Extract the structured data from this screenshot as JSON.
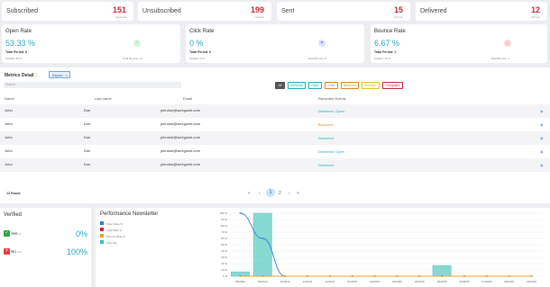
{
  "stats": [
    {
      "label": "Subscribed",
      "value": "151",
      "sub": "Add total"
    },
    {
      "label": "Unsubscribed",
      "value": "199",
      "sub": "Lifetime"
    },
    {
      "label": "Sent",
      "value": "15",
      "sub": "All time"
    },
    {
      "label": "Delivered",
      "value": "12",
      "sub": "All time"
    }
  ],
  "rates": [
    {
      "title": "Open Rate",
      "pct": "53.33 %",
      "total": "Total Period: 8",
      "foot_l": "Total(8): 53 %",
      "foot_r": "Total Bounce: 11",
      "icon": "trend-up-icon"
    },
    {
      "title": "Click Rate",
      "pct": "0 %",
      "total": "Total Period: 0",
      "foot_l": "Total(0): 0 %",
      "foot_r": "Total Bounce: 0",
      "icon": "click-icon"
    },
    {
      "title": "Bounce Rate",
      "pct": "6.67 %",
      "total": "Total Period: 1",
      "foot_l": "Total(1): 25 %",
      "foot_r": "Total Bounce: 1",
      "icon": "bounce-icon"
    }
  ],
  "metrics": {
    "title": "Metrics Detail",
    "export_label": "Export",
    "search_placeholder": "Search...",
    "filters": [
      {
        "label": "All",
        "color": "#555",
        "active": true
      },
      {
        "label": "Delivered",
        "color": "#2aa6bf"
      },
      {
        "label": "Open",
        "color": "#2aa6bf"
      },
      {
        "label": "Click",
        "color": "#e6822b"
      },
      {
        "label": "Bounced",
        "color": "#e6822b"
      },
      {
        "label": "Bounce",
        "color": "#e6c02b"
      },
      {
        "label": "Complaint",
        "color": "#c8283c"
      }
    ],
    "columns": {
      "name": "Name",
      "last": "Last name",
      "email": "Email",
      "events": "Recorded Events"
    },
    "rows": [
      {
        "name": "John",
        "last": "Doe",
        "email": "johndoe@we4guest.com",
        "events": "Delivered, Open",
        "color": "#2aa6bf"
      },
      {
        "name": "John",
        "last": "Doe",
        "email": "johndoe@we4guest.com",
        "events": "Bounced",
        "color": "#e6822b"
      },
      {
        "name": "John",
        "last": "Doe",
        "email": "johndoe@we4guest.com",
        "events": "Delivered",
        "color": "#2aa6bf"
      },
      {
        "name": "John",
        "last": "Doe",
        "email": "johndoe@we4guest.com",
        "events": "Delivered, Open",
        "color": "#2aa6bf"
      },
      {
        "name": "John",
        "last": "Doe",
        "email": "johndoe@we4guest.com",
        "events": "Delivered",
        "color": "#2aa6bf"
      }
    ],
    "found": "12 Found",
    "pages": [
      "«",
      "‹",
      "1",
      "2",
      "›",
      "»"
    ]
  },
  "verified": {
    "title": "Verified",
    "yes_label": "Yes",
    "yes_sub": "(0)",
    "yes_pct": "0%",
    "no_label": "No",
    "no_sub": "(12)",
    "no_pct": "100%"
  },
  "chart_data": {
    "type": "bar",
    "title": "Performance Newsletter",
    "categories": [
      "08/2024",
      "09/2024",
      "10/2024",
      "11/2024",
      "12/2024",
      "01/2025",
      "02/2025",
      "03/2025",
      "04/2025",
      "05/2025",
      "06/2025",
      "07/2025",
      "08/2025",
      "09/2025"
    ],
    "ylim": [
      0,
      100
    ],
    "yticks": [
      "100 %",
      "90 %",
      "80 %",
      "70 %",
      "60 %",
      "50 %",
      "40 %",
      "30 %",
      "20 %",
      "10 %",
      "0 %"
    ],
    "legend": [
      "Open Rate %",
      "Click Rate %",
      "Bounce Rate %",
      "Sent (%)"
    ],
    "series": [
      {
        "name": "Open Rate %",
        "color": "#3a7bd5",
        "type": "line",
        "values": [
          100,
          60,
          0,
          0,
          0,
          0,
          0,
          0,
          0,
          0,
          0,
          0,
          0,
          0
        ]
      },
      {
        "name": "Click Rate %",
        "color": "#c8283c",
        "type": "line",
        "values": [
          0,
          0,
          0,
          0,
          0,
          0,
          0,
          0,
          0,
          0,
          0,
          0,
          0,
          0
        ]
      },
      {
        "name": "Bounce Rate %",
        "color": "#e6a02b",
        "type": "line",
        "values": [
          0,
          0,
          0,
          0,
          0,
          0,
          0,
          0,
          0,
          0,
          0,
          0,
          0,
          0
        ]
      },
      {
        "name": "Sent (%)",
        "color": "#3bbfb5",
        "type": "bar",
        "values": [
          7,
          100,
          0,
          0,
          0,
          0,
          0,
          0,
          0,
          17,
          0,
          0,
          0,
          0
        ]
      }
    ]
  }
}
